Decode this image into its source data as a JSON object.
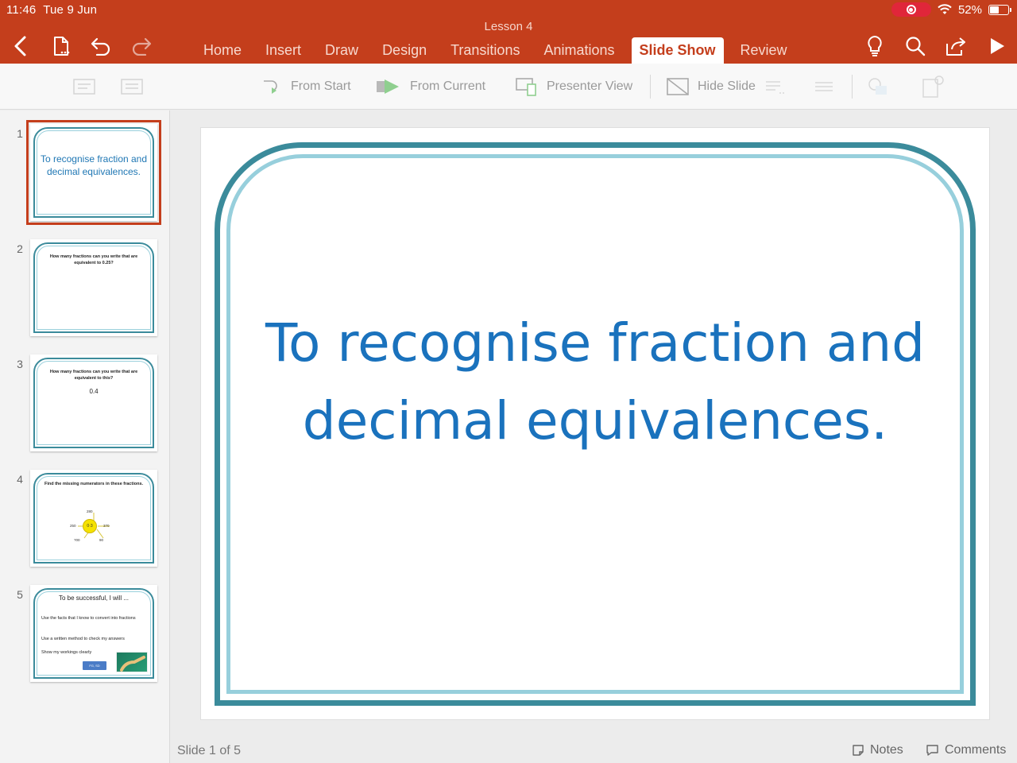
{
  "status": {
    "time": "11:46",
    "date": "Tue 9 Jun",
    "battery": "52%",
    "battery_level": 0.52
  },
  "header": {
    "doc_title": "Lesson 4",
    "tabs": [
      {
        "label": "Home"
      },
      {
        "label": "Insert"
      },
      {
        "label": "Draw"
      },
      {
        "label": "Design"
      },
      {
        "label": "Transitions"
      },
      {
        "label": "Animations"
      },
      {
        "label": "Slide Show",
        "active": true
      },
      {
        "label": "Review"
      }
    ]
  },
  "ribbon": {
    "from_start": "From Start",
    "from_current": "From Current",
    "presenter_view": "Presenter View",
    "hide_slide": "Hide Slide"
  },
  "thumbnails": [
    {
      "number": "1",
      "text": "To recognise fraction and decimal equivalences."
    },
    {
      "number": "2",
      "text": "How many fractions can you write that are equivalent to 0.25?"
    },
    {
      "number": "3",
      "text": "How many fractions can you write that are equivalent to this?",
      "value": "0.4"
    },
    {
      "number": "4",
      "text": "Find the missing numerators in these fractions.",
      "center": "0·3",
      "labels": [
        "280",
        "250",
        "370",
        "?00",
        "90"
      ]
    },
    {
      "number": "5",
      "title": "To be successful, I will ...",
      "lines": [
        "Use the facts that I know to convert into fractions",
        "Use a written method to check my answers",
        "Show my workings clearly"
      ],
      "badge": "FG, SD"
    }
  ],
  "slide": {
    "title": "To recognise fraction and decimal equivalences."
  },
  "footer": {
    "slide_count": "Slide 1 of 5",
    "notes": "Notes",
    "comments": "Comments"
  },
  "colors": {
    "header_red": "#c43e1c",
    "frame_dark": "#3b8b9b",
    "frame_light": "#97cfdc",
    "title_blue": "#1a72bd"
  }
}
